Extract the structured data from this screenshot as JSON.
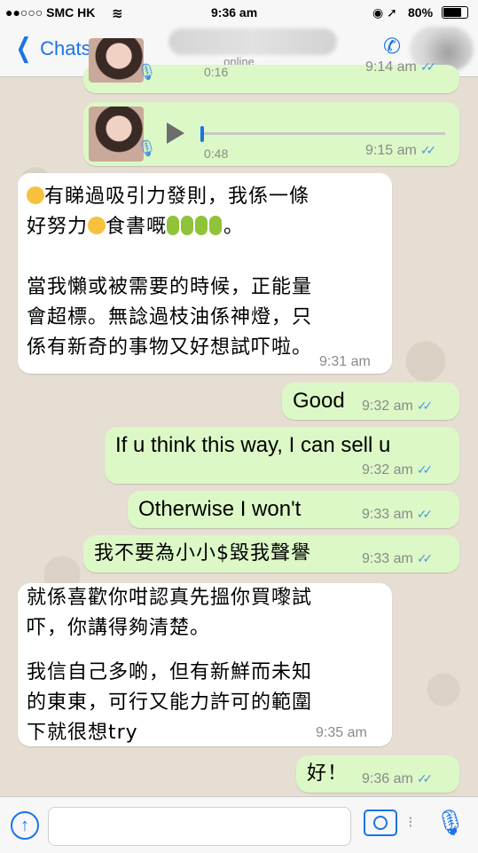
{
  "status": {
    "carrier": "●●○○○ SMC HK",
    "wifi": "wifi-icon",
    "time": "9:36 am",
    "battery": "80%"
  },
  "nav": {
    "back_label": "Chats (1)",
    "subtitle": "online"
  },
  "messages": [
    {
      "type": "voice",
      "dir": "out",
      "duration": "0:16",
      "time": "9:14 am"
    },
    {
      "type": "voice",
      "dir": "out",
      "duration": "0:48",
      "time": "9:15 am"
    },
    {
      "type": "text",
      "dir": "in",
      "lines": [
        "有睇過吸引力發則，我係一條",
        "好努力",
        "食書嘅",
        "。",
        "當我懶或被需要的時候，正能量",
        "會超標。無諗過枝油係神燈，只",
        "係有新奇的事物又好想試吓啦。"
      ],
      "time": "9:31 am"
    },
    {
      "type": "text",
      "dir": "out",
      "text": "Good",
      "time": "9:32 am"
    },
    {
      "type": "text",
      "dir": "out",
      "text": "If u think this way, I can sell u",
      "time": "9:32 am"
    },
    {
      "type": "text",
      "dir": "out",
      "text": "Otherwise I won't",
      "time": "9:33 am"
    },
    {
      "type": "text",
      "dir": "out",
      "text": "我不要為小小$毀我聲譽",
      "time": "9:33 am"
    },
    {
      "type": "text",
      "dir": "in",
      "lines": [
        "就係喜歡你咁認真先搵你買嚟試",
        "吓，你講得夠清楚。",
        "我信自己多啲，但有新鮮而未知",
        "的東東，可行又能力許可的範圍",
        "下就很想try"
      ],
      "time": "9:35 am"
    },
    {
      "type": "text",
      "dir": "out",
      "text": "好！",
      "time": "9:36 am"
    }
  ],
  "input": {
    "placeholder": ""
  }
}
